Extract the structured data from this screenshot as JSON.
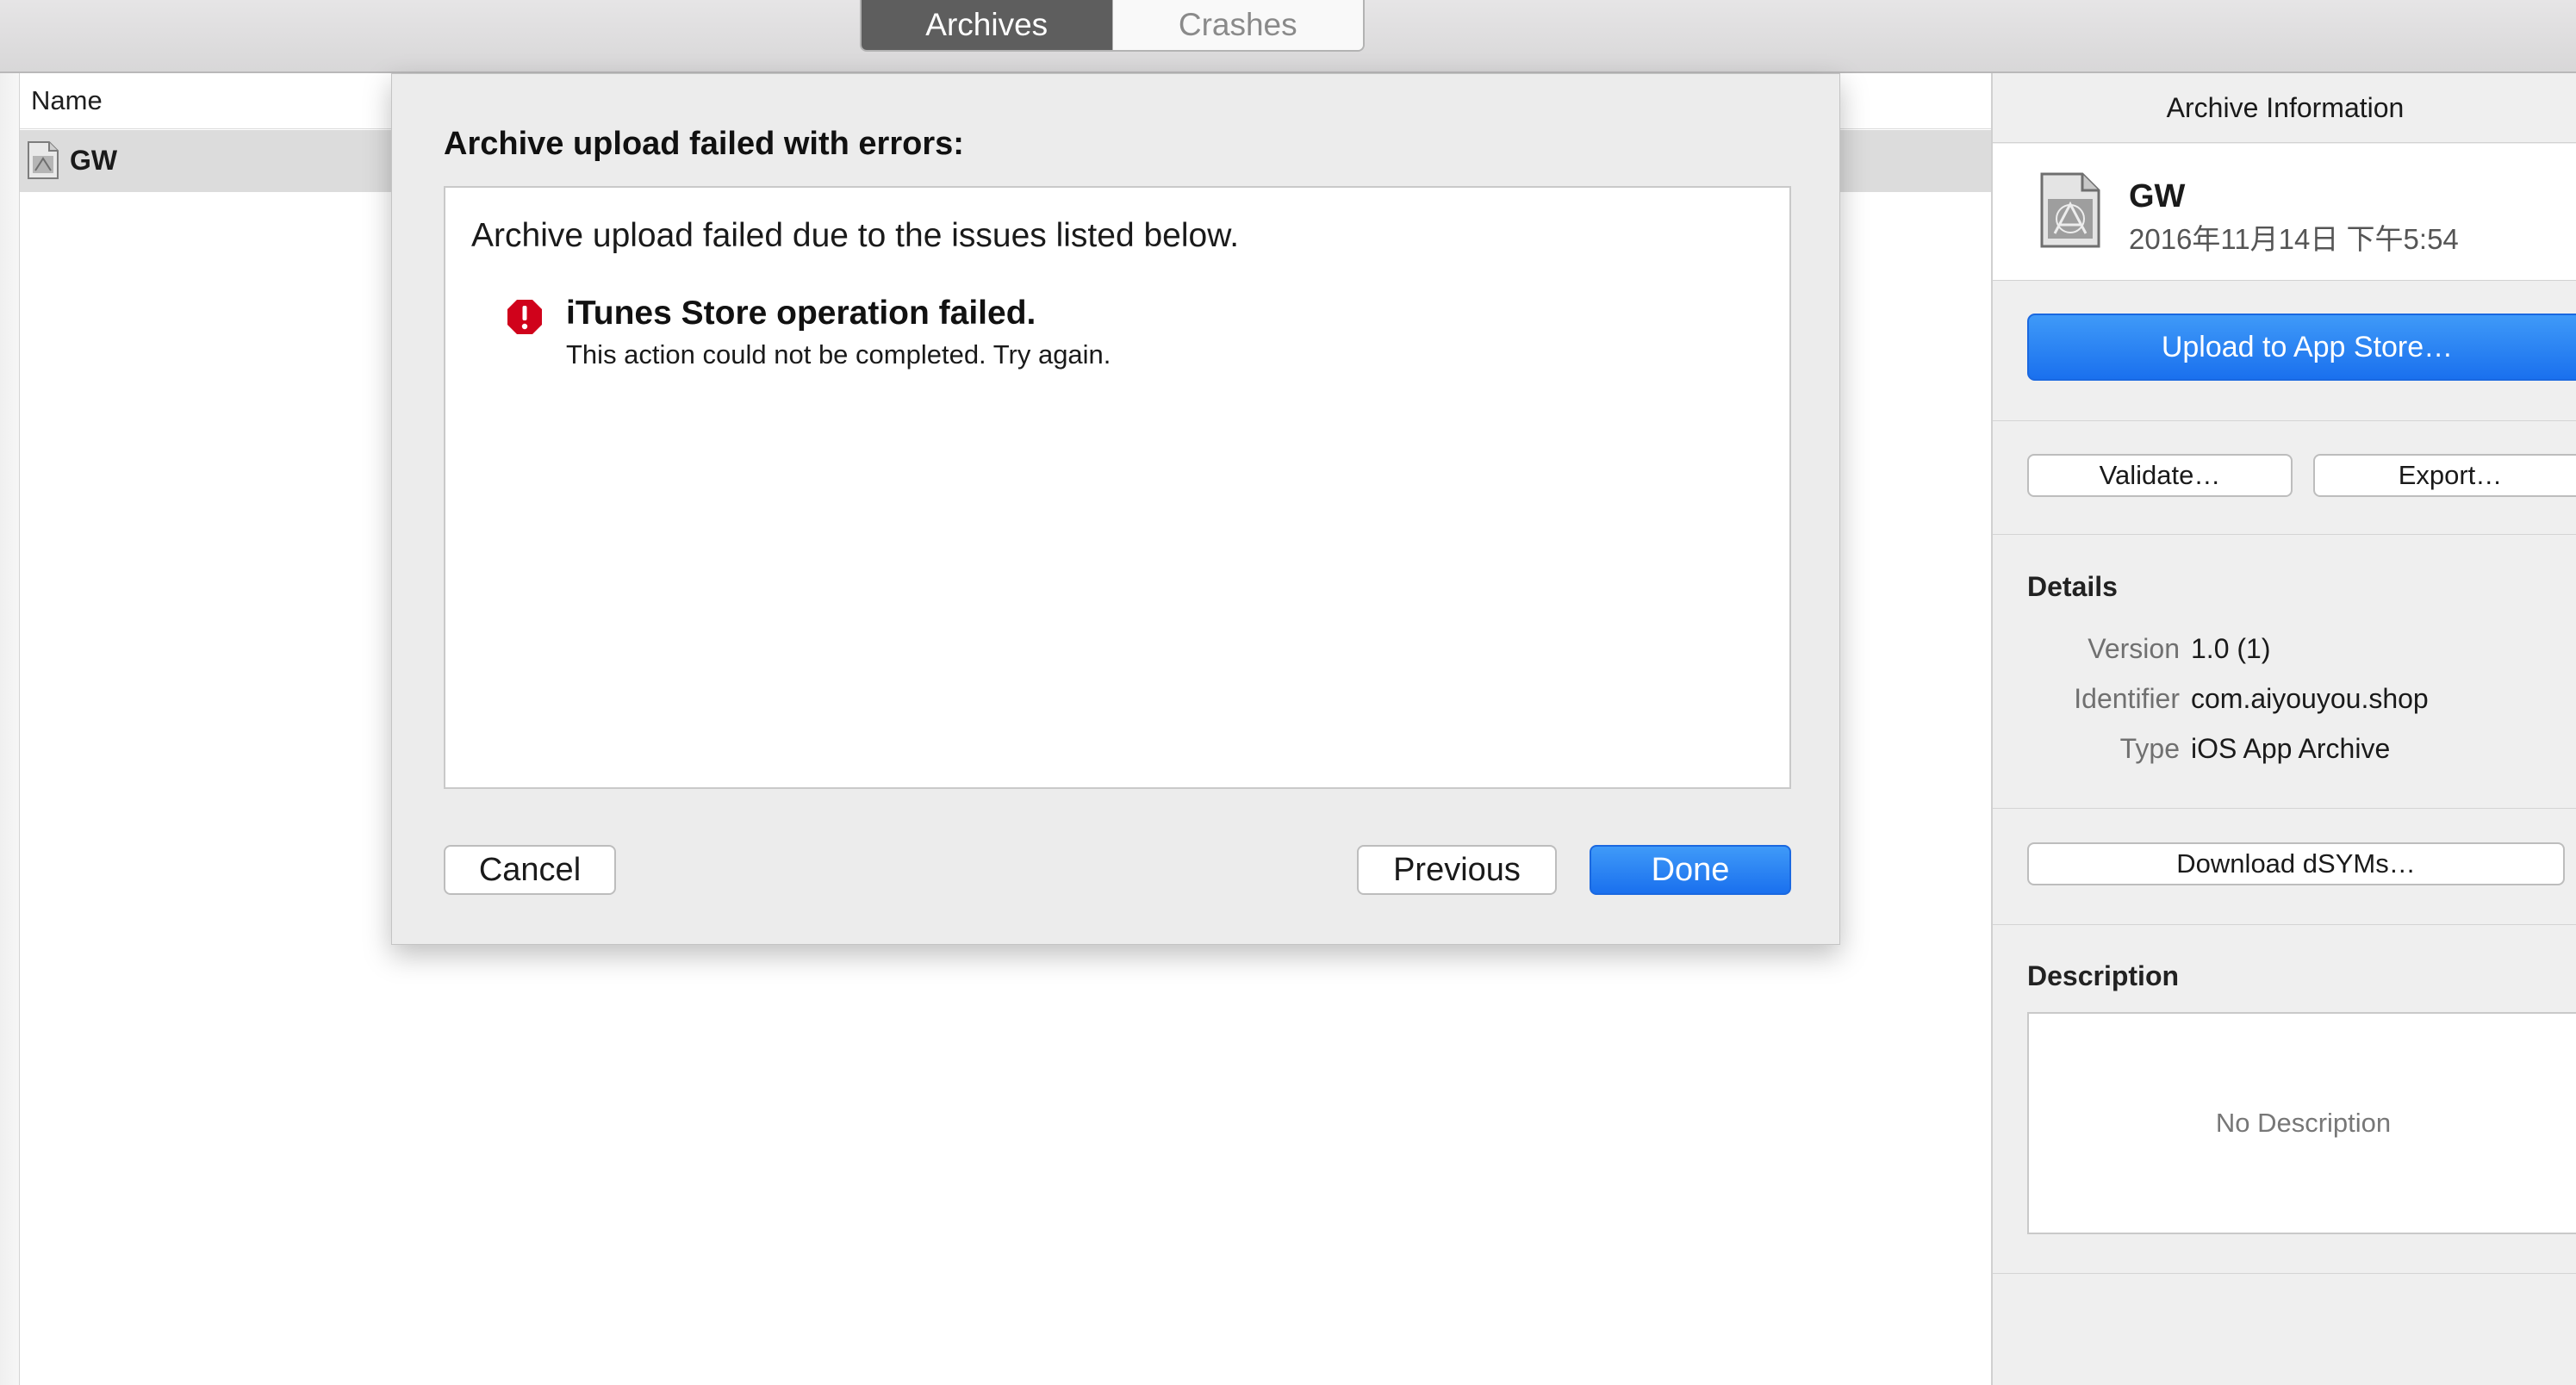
{
  "toolbar": {
    "tabs": [
      {
        "label": "Archives",
        "active": true
      },
      {
        "label": "Crashes",
        "active": false
      }
    ]
  },
  "archive_list": {
    "column_header": "Name",
    "rows": [
      {
        "name": "GW",
        "selected": true
      }
    ]
  },
  "dialog": {
    "title": "Archive upload failed with errors:",
    "intro": "Archive upload failed due to the issues listed below.",
    "issues": [
      {
        "icon": "error-icon",
        "title": "iTunes Store operation failed.",
        "detail": "This action could not be completed. Try again."
      }
    ],
    "buttons": {
      "cancel": "Cancel",
      "previous": "Previous",
      "done": "Done"
    }
  },
  "inspector": {
    "header": "Archive Information",
    "archive": {
      "name": "GW",
      "date": "2016年11月14日 下午5:54"
    },
    "actions": {
      "upload": "Upload to App Store…",
      "validate": "Validate…",
      "export": "Export…",
      "download_dsyms": "Download dSYMs…"
    },
    "details": {
      "title": "Details",
      "rows": [
        {
          "key": "Version",
          "value": "1.0 (1)"
        },
        {
          "key": "Identifier",
          "value": "com.aiyouyou.shop"
        },
        {
          "key": "Type",
          "value": "iOS App Archive"
        }
      ]
    },
    "description": {
      "title": "Description",
      "placeholder": "No Description"
    }
  },
  "colors": {
    "accent_blue": "#1a70ee",
    "error_red": "#d0021b",
    "active_tab": "#5e5e5e"
  }
}
